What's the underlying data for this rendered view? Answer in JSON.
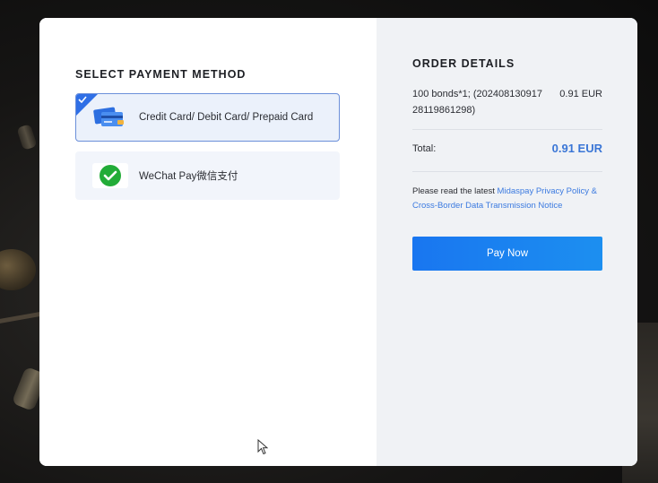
{
  "payment": {
    "section_title": "SELECT PAYMENT METHOD",
    "methods": [
      {
        "label": "Credit Card/ Debit Card/ Prepaid Card",
        "icon": "credit-card-icon",
        "selected": true
      },
      {
        "label": "WeChat Pay微信支付",
        "icon": "wechat-pay-icon",
        "selected": false
      }
    ]
  },
  "order": {
    "title": "ORDER DETAILS",
    "item_description": "100 bonds*1; (20240813091728119861298)",
    "item_price": "0.91 EUR",
    "total_label": "Total:",
    "total_value": "0.91 EUR",
    "notice_prefix": "Please read the latest ",
    "notice_link": "Midaspay Privacy Policy & Cross-Border Data Transmission Notice",
    "pay_button": "Pay Now"
  },
  "colors": {
    "accent": "#2f6fe6",
    "total_value": "#3a76d6",
    "button": "#1976f0",
    "link": "#3b7ae0"
  }
}
